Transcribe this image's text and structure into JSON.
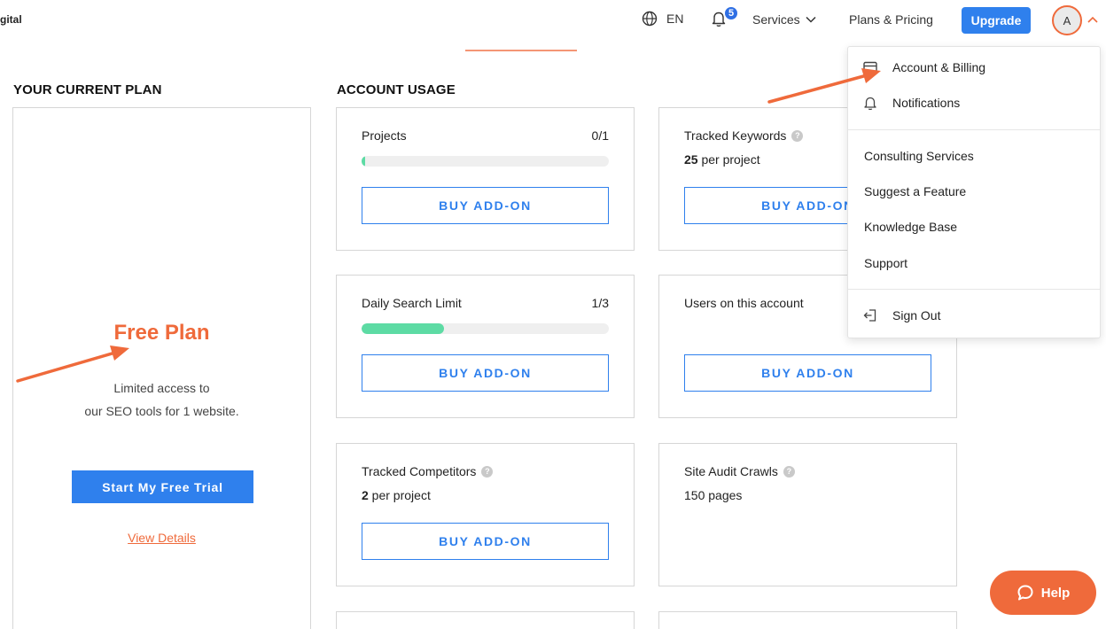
{
  "header": {
    "brand": "gital",
    "language": "EN",
    "notification_count": "5",
    "services_label": "Services",
    "plans_label": "Plans & Pricing",
    "upgrade_label": "Upgrade",
    "avatar_initial": "A"
  },
  "current_plan": {
    "heading": "YOUR CURRENT PLAN",
    "name": "Free Plan",
    "desc_line1": "Limited access to",
    "desc_line2": "our SEO tools for 1 website.",
    "trial_button": "Start My Free Trial",
    "details_link": "View Details"
  },
  "usage": {
    "heading": "ACCOUNT USAGE",
    "projects": {
      "title": "Projects",
      "count": "0/1",
      "progress_fraction": 0.0,
      "button": "BUY ADD-ON"
    },
    "tracked_keywords": {
      "title": "Tracked Keywords",
      "amount": "25",
      "unit": " per project",
      "button": "BUY ADD-ON"
    },
    "daily_search": {
      "title": "Daily Search Limit",
      "count": "1/3",
      "progress_fraction": 0.333,
      "button": "BUY ADD-ON"
    },
    "users": {
      "title": "Users on this account",
      "button": "BUY ADD-ON"
    },
    "tracked_competitors": {
      "title": "Tracked Competitors",
      "amount": "2",
      "unit": " per project",
      "button": "BUY ADD-ON"
    },
    "site_audit": {
      "title": "Site Audit Crawls",
      "sub": "150 pages"
    }
  },
  "dropdown": {
    "account_billing": "Account & Billing",
    "notifications": "Notifications",
    "consulting": "Consulting Services",
    "suggest": "Suggest a Feature",
    "knowledge": "Knowledge Base",
    "support": "Support",
    "sign_out": "Sign Out"
  },
  "help_label": "Help",
  "colors": {
    "accent": "#2f80ed",
    "brand_orange": "#ef6a3b",
    "progress": "#5ddba4"
  }
}
